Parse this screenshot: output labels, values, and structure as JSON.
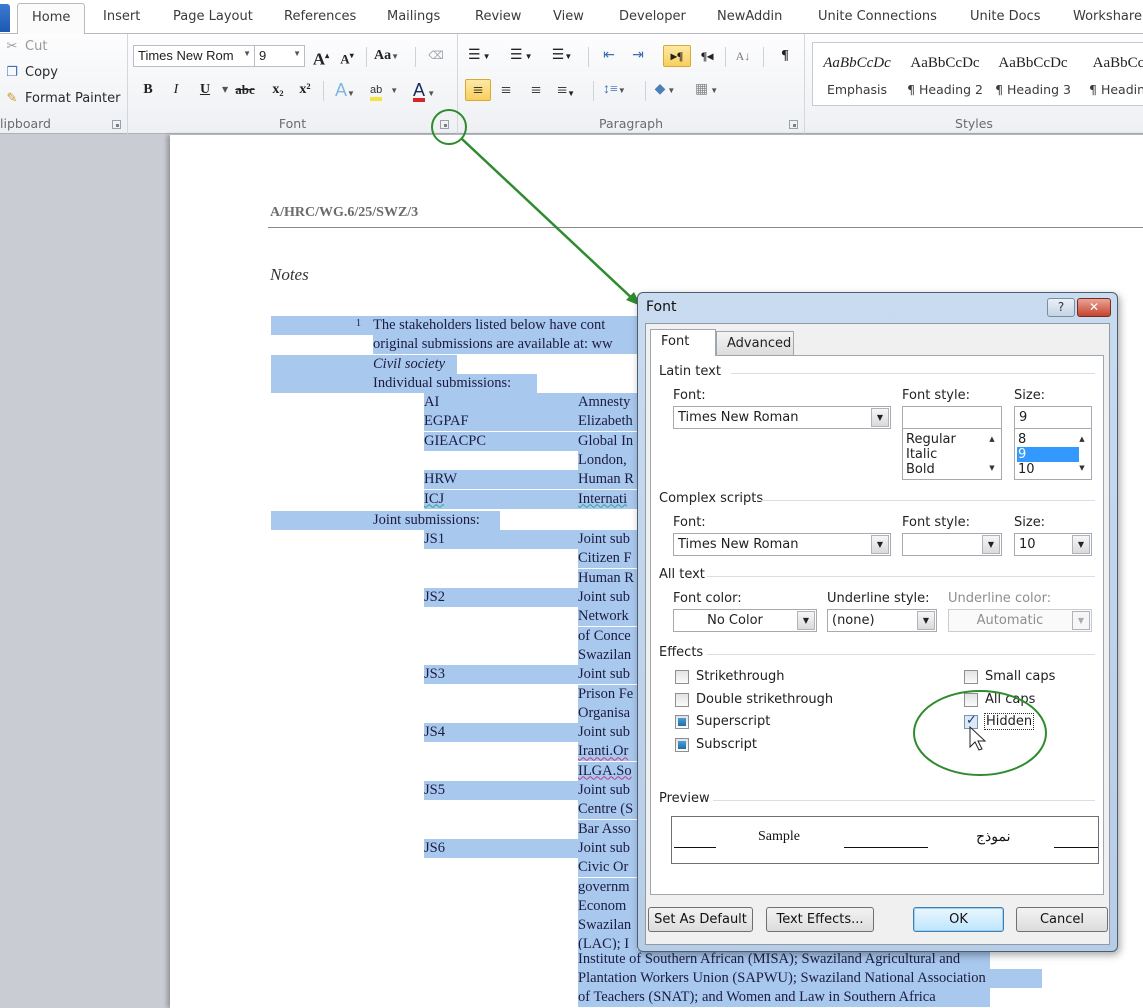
{
  "ribbon": {
    "tabs": [
      "Home",
      "Insert",
      "Page Layout",
      "References",
      "Mailings",
      "Review",
      "View",
      "Developer",
      "NewAddin",
      "Unite Connections",
      "Unite Docs",
      "Workshare"
    ],
    "active_tab": "Home",
    "clipboard": {
      "label": "lipboard",
      "cut": "Cut",
      "copy": "Copy",
      "format_painter": "Format Painter"
    },
    "font": {
      "label": "Font",
      "font_name": "Times New Rom",
      "font_size": "9",
      "grow": "A",
      "shrink": "A",
      "change_case": "Aa",
      "bold": "B",
      "italic": "I",
      "underline": "U",
      "strikethrough": "abc",
      "subscript": "x₂",
      "superscript": "x²",
      "text_effects": "A",
      "highlight": "ab",
      "font_color": "A",
      "font_color_swatch": "#d8252b",
      "highlight_swatch": "#f5e43b"
    },
    "paragraph": {
      "label": "Paragraph",
      "bullets": "☰",
      "numbering": "☰",
      "multilevel": "☰",
      "decrease_indent": "⇤",
      "increase_indent": "⇥",
      "ltr": "▸¶",
      "rtl": "¶◂",
      "sort": "A↓",
      "show_marks": "¶",
      "align_left": "≡",
      "center": "≡",
      "align_right": "≡",
      "justify": "≡",
      "line_spacing": "↕≡",
      "shading": "◆",
      "borders": "▦"
    },
    "styles": {
      "label": "Styles",
      "items": [
        {
          "sample": "AaBbCcDc",
          "name": "Emphasis"
        },
        {
          "sample": "AaBbCcDc",
          "name": "¶ Heading 2"
        },
        {
          "sample": "AaBbCcDc",
          "name": "¶ Heading 3"
        },
        {
          "sample": "AaBbCcI",
          "name": "¶ Heading"
        }
      ]
    }
  },
  "document": {
    "header": "A/HRC/WG.6/25/SWZ/3",
    "notes_heading": "Notes",
    "footnote_number": "1",
    "lines": [
      "The stakeholders listed below have cont",
      "original  submissions are available at: ww",
      "Civil society",
      "Individual submissions:"
    ],
    "individual": [
      {
        "code": "AI",
        "name": "Amnesty"
      },
      {
        "code": "EGPAF",
        "name": "Elizabeth"
      },
      {
        "code": "GIEACPC",
        "name": "Global In"
      },
      {
        "code": "",
        "name": "London,"
      },
      {
        "code": "HRW",
        "name": "Human R"
      },
      {
        "code": "ICJ",
        "name": "Internati"
      }
    ],
    "joint_label": "Joint submissions:",
    "joint": [
      {
        "code": "JS1",
        "lines": [
          "Joint sub",
          "Citizen F",
          "Human R"
        ]
      },
      {
        "code": "JS2",
        "lines": [
          "Joint sub",
          "Network",
          "of Conce",
          "Swazilan"
        ]
      },
      {
        "code": "JS3",
        "lines": [
          "Joint sub",
          "Prison Fe",
          "Organisa"
        ]
      },
      {
        "code": "JS4",
        "lines": [
          "Joint sub",
          "Iranti.Or",
          "ILGA.So"
        ]
      },
      {
        "code": "JS5",
        "lines": [
          "Joint sub",
          "Centre (S",
          "Bar Asso"
        ]
      },
      {
        "code": "JS6",
        "lines": [
          "Joint sub",
          "Civic Or",
          "governm",
          "Econom",
          "Swazilan",
          "(LAC); I"
        ]
      }
    ],
    "tail_lines": [
      "Institute of Southern African (MISA);  Swaziland Agricultural  and",
      "Plantation Workers Union (SAPWU);   Swaziland National Association",
      "of Teachers (SNAT);  and Women and Law in  Southern Africa"
    ]
  },
  "dialog": {
    "title": "Font",
    "help": "?",
    "close": "✕",
    "tabs": {
      "font": "Font",
      "advanced": "Advanced"
    },
    "latin": {
      "section": "Latin text",
      "font_label": "Font:",
      "font_value": "Times New Roman",
      "style_label": "Font style:",
      "style_value": "",
      "style_options": [
        "Regular",
        "Italic",
        "Bold"
      ],
      "size_label": "Size:",
      "size_value": "9",
      "size_options": [
        "8",
        "9",
        "10"
      ],
      "size_selected": "9"
    },
    "complex": {
      "section": "Complex scripts",
      "font_label": "Font:",
      "font_value": "Times New Roman",
      "style_label": "Font style:",
      "style_value": "",
      "size_label": "Size:",
      "size_value": "10"
    },
    "all_text": {
      "section": "All text",
      "color_label": "Font color:",
      "color_value": "No Color",
      "underline_label": "Underline style:",
      "underline_value": "(none)",
      "underline_color_label": "Underline color:",
      "underline_color_value": "Automatic"
    },
    "effects": {
      "section": "Effects",
      "strikethrough": {
        "label": "Strikethrough",
        "state": "unchecked"
      },
      "double_strikethrough": {
        "label": "Double strikethrough",
        "state": "unchecked"
      },
      "superscript": {
        "label": "Superscript",
        "state": "indeterminate"
      },
      "subscript": {
        "label": "Subscript",
        "state": "indeterminate"
      },
      "small_caps": {
        "label": "Small caps",
        "state": "unchecked"
      },
      "all_caps": {
        "label": "All caps",
        "state": "unchecked"
      },
      "hidden": {
        "label": "Hidden",
        "state": "checked"
      }
    },
    "preview": {
      "section": "Preview",
      "sample": "Sample",
      "sample_rtl": "نموذج"
    },
    "buttons": {
      "set_default": "Set As Default",
      "text_effects": "Text Effects...",
      "ok": "OK",
      "cancel": "Cancel"
    }
  },
  "annotation": {
    "color": "#2e8b2e"
  }
}
